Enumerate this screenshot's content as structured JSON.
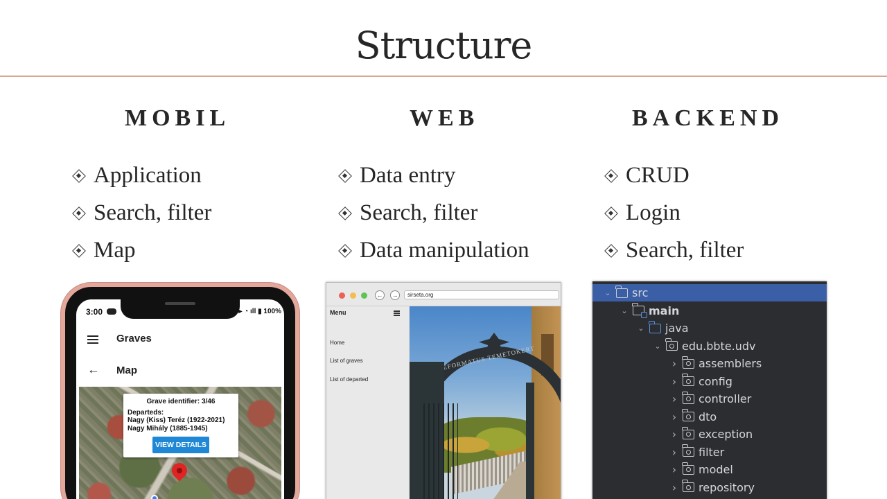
{
  "slide": {
    "title": "Structure"
  },
  "columns": [
    {
      "heading": "MOBIL",
      "items": [
        "Application",
        "Search, filter",
        "Map"
      ]
    },
    {
      "heading": "WEB",
      "items": [
        "Data entry",
        "Search, filter",
        "Data manipulation"
      ]
    },
    {
      "heading": "BACKEND",
      "items": [
        "CRUD",
        "Login",
        "Search, filter"
      ]
    }
  ],
  "mobile": {
    "time": "3:00",
    "battery": "100%",
    "app_title": "Graves",
    "sub_title": "Map",
    "popup": {
      "grave_id": "Grave identifier: 3/46",
      "departed_label": "Departeds:",
      "departed": [
        "Nagy (Kiss) Teréz (1922-2021)",
        "Nagy Mihály (1885-1945)"
      ],
      "button": "VIEW DETAILS"
    }
  },
  "web": {
    "url": "sirseta.org",
    "menu_label": "Menu",
    "links": [
      "Home",
      "List of graves",
      "List of departed"
    ],
    "gate_inscription": "REFORMATUS TEMETOKERT"
  },
  "backend": {
    "tree": [
      {
        "label": "src",
        "depth": 0,
        "kind": "src",
        "selected": true
      },
      {
        "label": "main",
        "depth": 1,
        "kind": "main",
        "bold": true
      },
      {
        "label": "java",
        "depth": 2,
        "kind": "java"
      },
      {
        "label": "edu.bbte.udv",
        "depth": 3,
        "kind": "package"
      },
      {
        "label": "assemblers",
        "depth": 4,
        "kind": "package"
      },
      {
        "label": "config",
        "depth": 4,
        "kind": "package"
      },
      {
        "label": "controller",
        "depth": 4,
        "kind": "package"
      },
      {
        "label": "dto",
        "depth": 4,
        "kind": "package"
      },
      {
        "label": "exception",
        "depth": 4,
        "kind": "package"
      },
      {
        "label": "filter",
        "depth": 4,
        "kind": "package"
      },
      {
        "label": "model",
        "depth": 4,
        "kind": "package"
      },
      {
        "label": "repository",
        "depth": 4,
        "kind": "package"
      }
    ]
  },
  "colors": {
    "rule": "#d9a493",
    "phone_frame": "#e3a79b",
    "popup_button": "#1e88d6",
    "map_pin": "#e02424",
    "tree_background": "#2b2d30",
    "tree_selected": "#3b5fa6"
  }
}
